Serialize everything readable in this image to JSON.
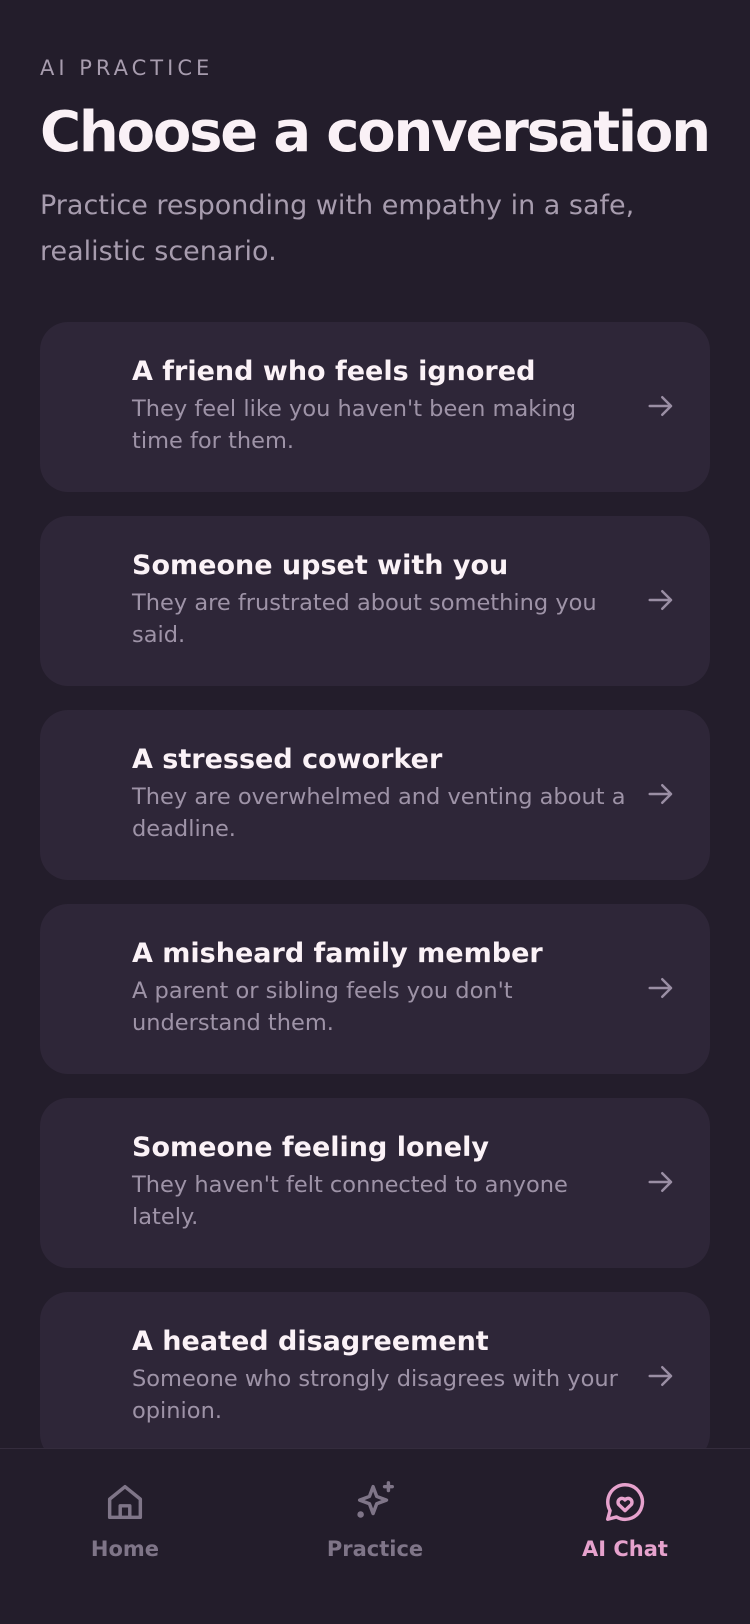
{
  "header": {
    "eyebrow": "AI PRACTICE",
    "title": "Choose a conversation",
    "subtitle": "Practice responding with empathy in a safe, realistic scenario."
  },
  "scenarios": [
    {
      "title": "A friend who feels ignored",
      "description": "They feel like you haven't been making time for them."
    },
    {
      "title": "Someone upset with you",
      "description": "They are frustrated about something you said."
    },
    {
      "title": "A stressed coworker",
      "description": "They are overwhelmed and venting about a deadline."
    },
    {
      "title": "A misheard family member",
      "description": "A parent or sibling feels you don't understand them."
    },
    {
      "title": "Someone feeling lonely",
      "description": "They haven't felt connected to anyone lately."
    },
    {
      "title": "A heated disagreement",
      "description": "Someone who strongly disagrees with your opinion."
    }
  ],
  "nav": {
    "items": [
      {
        "label": "Home",
        "icon": "home-icon",
        "active": false
      },
      {
        "label": "Practice",
        "icon": "sparkle-icon",
        "active": false
      },
      {
        "label": "AI Chat",
        "icon": "chat-heart-icon",
        "active": true
      }
    ]
  },
  "colors": {
    "background": "#231d2b",
    "card": "#2e2638",
    "accent": "#e6a2cd",
    "muted": "#a79cae"
  }
}
